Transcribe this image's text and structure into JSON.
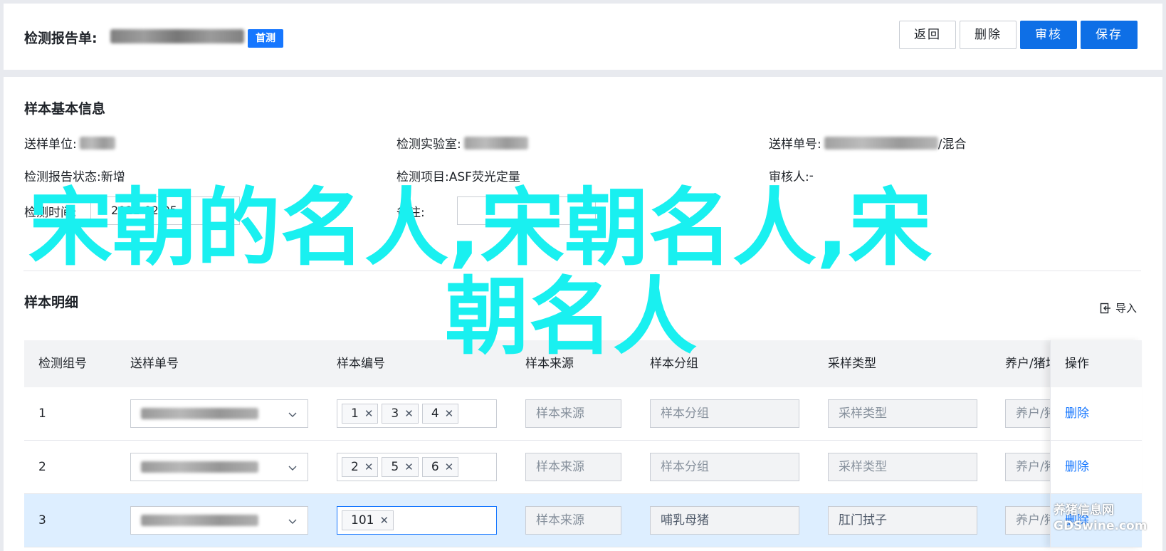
{
  "header": {
    "title": "检测报告单:",
    "badge": "首测",
    "buttons": {
      "back": "返回",
      "delete": "删除",
      "review": "审核",
      "save": "保存"
    }
  },
  "basic_info": {
    "section_title": "样本基本信息",
    "fields": {
      "sender_unit_label": "送样单位:",
      "lab_label": "检测实验室:",
      "order_no_label": "送样单号:",
      "order_no_suffix": "/混合",
      "status_label": "检测报告状态:",
      "status_value": "新增",
      "item_label": "检测项目:",
      "item_value": "ASF荧光定量",
      "reviewer_label": "审核人:",
      "reviewer_value": "-",
      "date_label": "检测时间:",
      "date_value": "2021-02-05",
      "remark_label": "备注:"
    }
  },
  "detail": {
    "section_title": "样本明细",
    "import_label": "导入",
    "columns": [
      "检测组号",
      "送样单号",
      "样本编号",
      "样本来源",
      "样本分组",
      "采样类型",
      "养户/猪场",
      "操作"
    ],
    "rows": [
      {
        "index": "1",
        "tags": [
          "1",
          "3",
          "4"
        ],
        "source": "样本来源",
        "group": "样本分组",
        "type": "采样类型",
        "farm": "养户/猪场",
        "action": "删除"
      },
      {
        "index": "2",
        "tags": [
          "2",
          "5",
          "6"
        ],
        "source": "样本来源",
        "group": "样本分组",
        "type": "采样类型",
        "farm": "养户/猪场",
        "action": "删除"
      },
      {
        "index": "3",
        "tags": [
          "101"
        ],
        "source": "样本来源",
        "group": "哺乳母猪",
        "type": "肛门拭子",
        "farm": "养户/猪场",
        "action": "删除"
      }
    ]
  },
  "overlay": {
    "line1": "宋朝的名人,宋朝名人,宋",
    "line2": "朝名人"
  },
  "site_mark": {
    "line1": "养猪信息网",
    "line2": "GDSwine.com"
  },
  "colors": {
    "primary": "#0e6fe6",
    "link": "#1677ff",
    "overlay": "#19f0f0",
    "selected_row": "#ddeeff"
  }
}
